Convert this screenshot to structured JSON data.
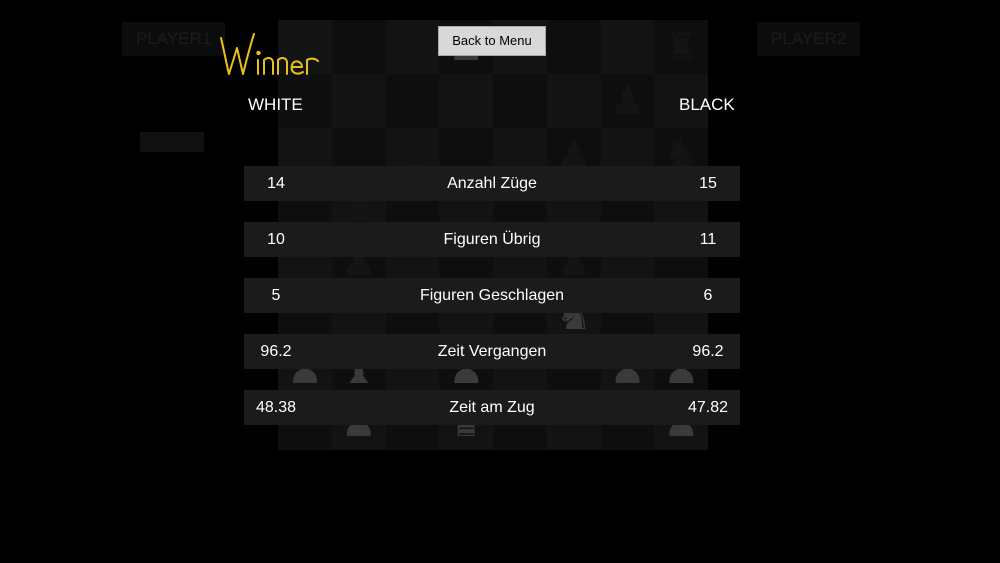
{
  "header": {
    "back_button_label": "Back to Menu",
    "winner_text": "Winner",
    "player1_label": "PLAYER1",
    "player2_label": "PLAYER2",
    "winner_color": "#e8c21a"
  },
  "sides": {
    "left": "WHITE",
    "right": "BLACK"
  },
  "stats": [
    {
      "name": "Anzahl Züge",
      "white": "14",
      "black": "15"
    },
    {
      "name": "Figuren Übrig",
      "white": "10",
      "black": "11"
    },
    {
      "name": "Figuren Geschlagen",
      "white": "5",
      "black": "6"
    },
    {
      "name": "Zeit Vergangen",
      "white": "96.2",
      "black": "96.2"
    },
    {
      "name": "Zeit am Zug",
      "white": "48.38",
      "black": "47.82"
    }
  ]
}
